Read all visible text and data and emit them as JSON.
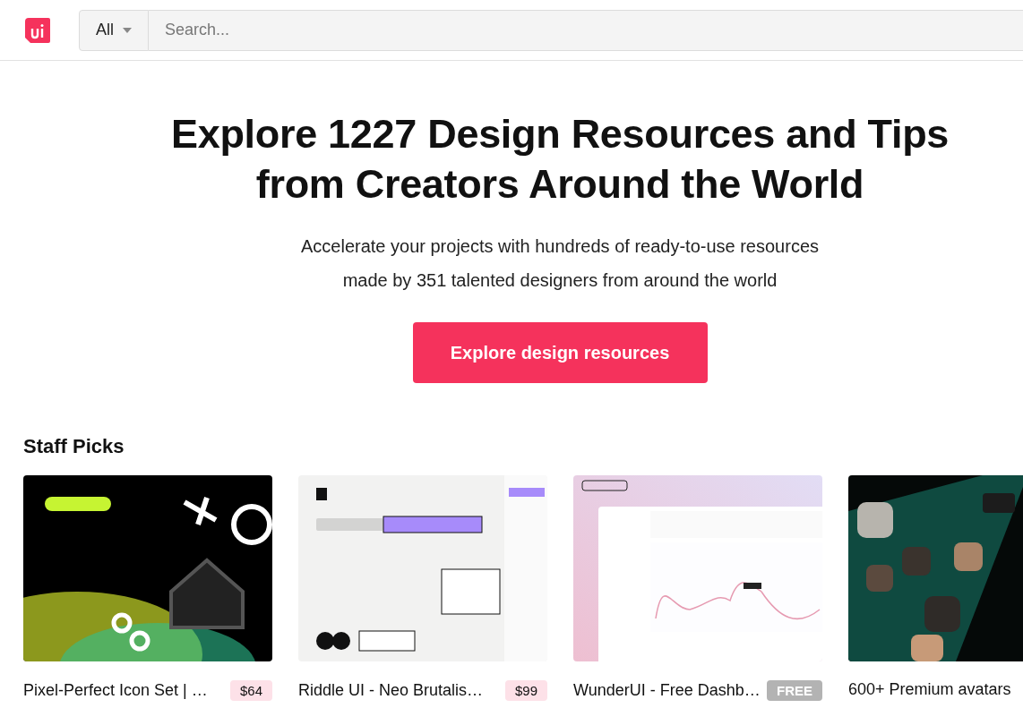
{
  "header": {
    "category": "All",
    "search": {
      "placeholder": "Search..."
    }
  },
  "hero": {
    "title_lines": [
      "Explore 1227 Design Resources and Tips",
      "from Creators Around the World"
    ],
    "subtitle_lines": [
      "Accelerate your projects with hundreds of ready-to-use resources",
      "made by 351 talented designers from around the world"
    ],
    "button": "Explore design resources"
  },
  "staff_picks": {
    "heading": "Staff Picks",
    "cards": [
      {
        "title": "Pixel-Perfect Icon Set | …",
        "price": {
          "kind": "paid",
          "text": "$64"
        }
      },
      {
        "title": "Riddle UI - Neo Brutalis…",
        "price": {
          "kind": "paid",
          "text": "$99"
        }
      },
      {
        "title": "WunderUI - Free Dashb…",
        "price": {
          "kind": "free",
          "text": "FREE"
        }
      },
      {
        "title": "600+ Premium avatars"
      }
    ]
  }
}
